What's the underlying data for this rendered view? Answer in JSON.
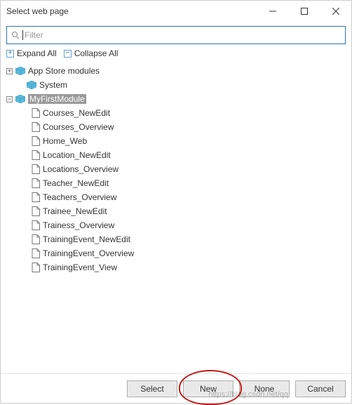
{
  "window": {
    "title": "Select web page"
  },
  "filter": {
    "placeholder": "Filter"
  },
  "toolbar": {
    "expand_all": "Expand All",
    "collapse_all": "Collapse All"
  },
  "tree": {
    "app_store": "App Store modules",
    "system": "System",
    "my_module": "MyFirstModule",
    "pages": [
      "Courses_NewEdit",
      "Courses_Overview",
      "Home_Web",
      "Location_NewEdit",
      "Locations_Overview",
      "Teacher_NewEdit",
      "Teachers_Overview",
      "Trainee_NewEdit",
      "Trainess_Overview",
      "TrainingEvent_NewEdit",
      "TrainingEvent_Overview",
      "TrainingEvent_View"
    ]
  },
  "buttons": {
    "select": "Select",
    "new": "New",
    "none": "None",
    "cancel": "Cancel"
  },
  "watermark": "https://blog.csdn.net/qq"
}
